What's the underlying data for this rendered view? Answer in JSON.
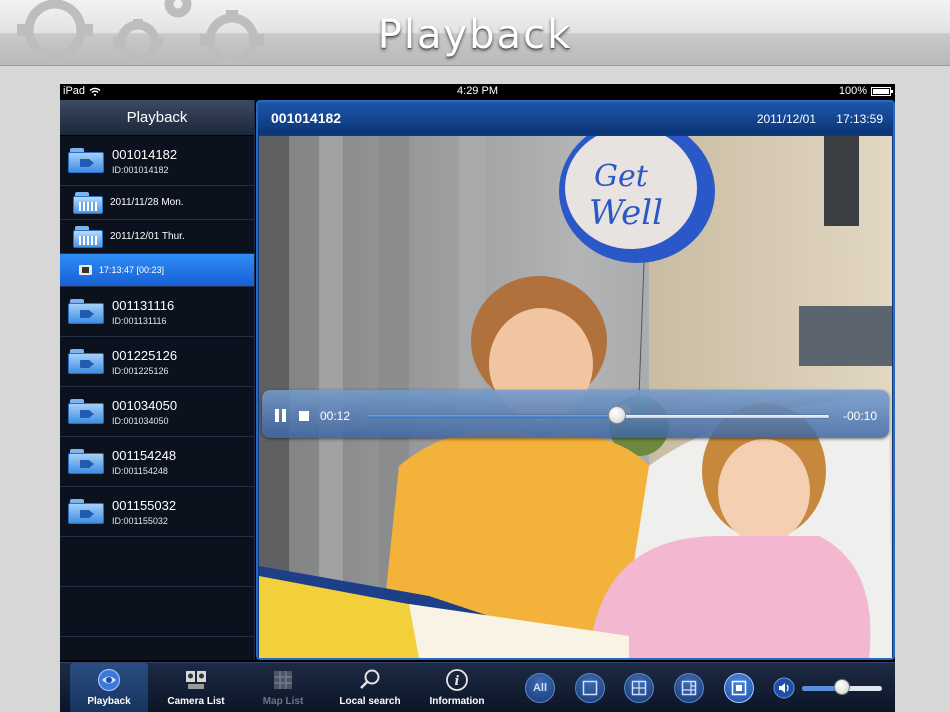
{
  "banner": {
    "title": "Playback"
  },
  "statusbar": {
    "device": "iPad",
    "time": "4:29 PM",
    "battery": "100%"
  },
  "sidebar": {
    "title": "Playback",
    "items": [
      {
        "type": "camera",
        "name": "001014182",
        "id": "ID:001014182"
      },
      {
        "type": "date",
        "label": "2011/11/28 Mon."
      },
      {
        "type": "date",
        "label": "2011/12/01 Thur."
      },
      {
        "type": "clip",
        "label": "17:13:47 [00:23]"
      },
      {
        "type": "camera",
        "name": "001131116",
        "id": "ID:001131116"
      },
      {
        "type": "camera",
        "name": "001225126",
        "id": "ID:001225126"
      },
      {
        "type": "camera",
        "name": "001034050",
        "id": "ID:001034050"
      },
      {
        "type": "camera",
        "name": "001154248",
        "id": "ID:001154248"
      },
      {
        "type": "camera",
        "name": "001155032",
        "id": "ID:001155032"
      }
    ]
  },
  "player": {
    "camera_name": "001014182",
    "date": "2011/12/01",
    "time": "17:13:59",
    "elapsed": "00:12",
    "remaining": "-00:10",
    "progress": 0.54
  },
  "toolbar": {
    "tabs": [
      {
        "label": "Playback",
        "icon": "playback-icon",
        "active": true,
        "disabled": false
      },
      {
        "label": "Camera List",
        "icon": "camera-list-icon",
        "active": false,
        "disabled": false
      },
      {
        "label": "Map List",
        "icon": "map-list-icon",
        "active": false,
        "disabled": true
      },
      {
        "label": "Local search",
        "icon": "search-icon",
        "active": false,
        "disabled": false
      },
      {
        "label": "Information",
        "icon": "info-icon",
        "active": false,
        "disabled": false
      }
    ],
    "layout_all_label": "All",
    "volume_level": 0.5
  },
  "colors": {
    "accent": "#1e56ab",
    "selected_row": "#2f8df7",
    "sidebar_bg": "#0b111d"
  }
}
